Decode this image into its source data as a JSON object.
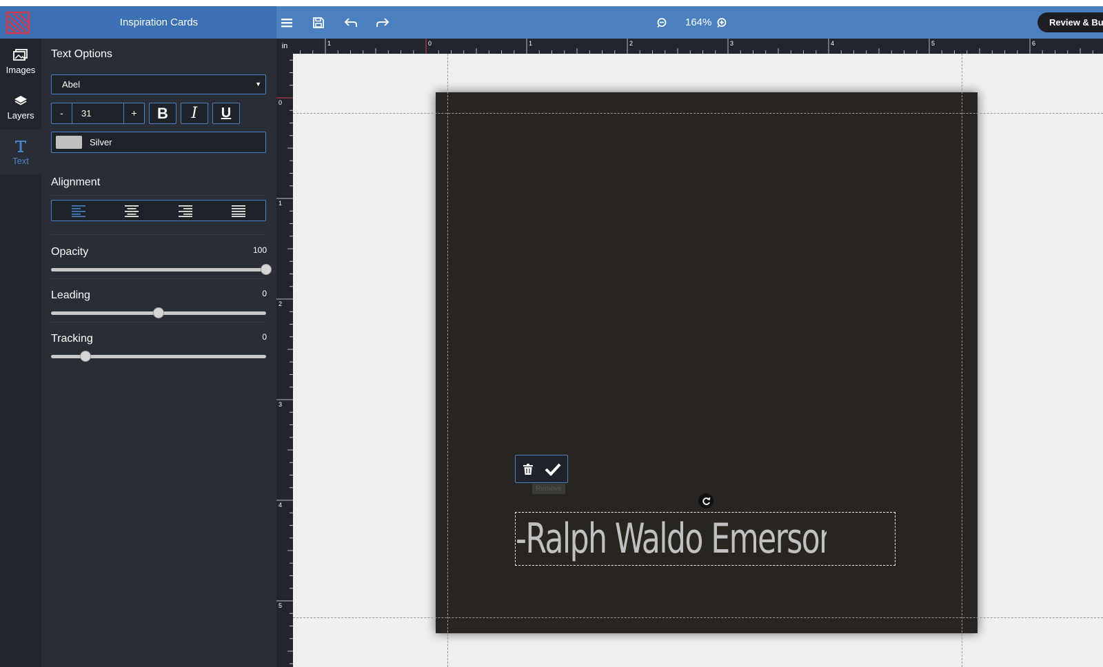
{
  "app": {
    "title": "Inspiration Cards"
  },
  "toolbar": {
    "zoom": "164%",
    "review_label": "Review & Bu"
  },
  "nav": {
    "items": [
      {
        "label": "Images",
        "icon": "images-icon"
      },
      {
        "label": "Layers",
        "icon": "layers-icon"
      },
      {
        "label": "Text",
        "icon": "text-icon",
        "active": true
      }
    ]
  },
  "panel": {
    "heading": "Text Options",
    "font": "Abel",
    "size": "31",
    "minus": "-",
    "plus": "+",
    "bold": "B",
    "italic": "I",
    "underline": "U",
    "color": {
      "name": "Silver",
      "hex": "#c0c0c0"
    },
    "alignment_heading": "Alignment",
    "alignment_selected": "left",
    "opacity": {
      "label": "Opacity",
      "value": "100",
      "fraction": 1.0
    },
    "leading": {
      "label": "Leading",
      "value": "0",
      "fraction": 0.5
    },
    "tracking": {
      "label": "Tracking",
      "value": "0",
      "fraction": 0.16
    }
  },
  "ruler": {
    "unit": "in",
    "top_labels": [
      "1",
      "0",
      "1",
      "2",
      "3",
      "4",
      "5",
      "6"
    ],
    "left_labels": [
      "0",
      "1",
      "2",
      "3",
      "4",
      "5"
    ]
  },
  "canvas": {
    "card_color": "#28241f",
    "text": "-Ralph Waldo Emerson",
    "tooltip": "Remove"
  },
  "colors": {
    "header": "#3b70b5",
    "toolbar": "#4a7fc0",
    "panel": "#282d36",
    "rail": "#20252e",
    "accent": "#4a80c6"
  }
}
